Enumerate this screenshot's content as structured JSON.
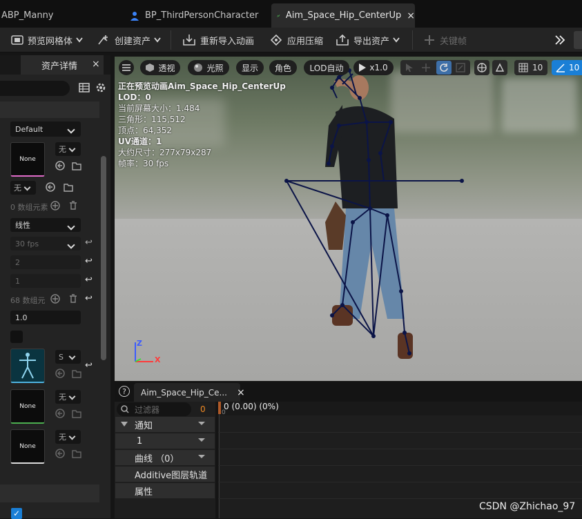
{
  "tabs": [
    {
      "label": "ABP_Manny"
    },
    {
      "label": "BP_ThirdPersonCharacter"
    },
    {
      "label": "Aim_Space_Hip_CenterUp",
      "close": "×"
    }
  ],
  "toolbar": {
    "preview_mesh": "预览网格体",
    "create_asset": "创建资产",
    "reimport": "重新导入动画",
    "apply_compression": "应用压缩",
    "export_asset": "导出资产",
    "keyframe": "关键帧"
  },
  "details": {
    "tab_label": "资产详情",
    "close": "×",
    "fields": {
      "default": "Default",
      "none1": "None",
      "sel_a": "无",
      "sel_b": "无",
      "array0": "0 数组元素",
      "interp": "线性",
      "fps": "30 fps",
      "val2": "2",
      "val1": "1",
      "array68": "68 数组元",
      "rate": "1.0",
      "skel_sel": "S",
      "none2": "None",
      "sel_c": "无",
      "none3": "None",
      "sel_d": "无"
    }
  },
  "viewport": {
    "buttons": {
      "perspective": "透视",
      "lit": "光照",
      "show": "显示",
      "character": "角色",
      "lod": "LOD自动",
      "speed": "x1.0",
      "grid": "10",
      "angle": "10"
    },
    "stats": [
      "正在预览动画Aim_Space_Hip_CenterUp",
      "LOD：0",
      "当前屏幕大小：1.484",
      "三角形：115,512",
      "顶点：64,352",
      "UV通道：1",
      "大约尺寸：277x79x287",
      "帧率：30 fps"
    ],
    "axis": {
      "z": "Z",
      "x": "X"
    }
  },
  "timeline": {
    "tab_label": "Aim_Space_Hip_Ce...",
    "close": "×",
    "help": "?",
    "filter_placeholder": "过滤器",
    "frame_count": "0",
    "frame_label": "0 (0.00) (0%)",
    "frame_tick": "0",
    "rows": {
      "notify": "通知",
      "track1": "1",
      "curves": "曲线 （0）",
      "additive": "Additive图层轨道",
      "attributes": "属性"
    }
  },
  "watermark": "CSDN @Zhichao_97",
  "colors": {
    "accent": "#1a7fd6",
    "active_tab_icon": "#4caf50",
    "axis_x": "#ff3a3a",
    "axis_z": "#3b5bff",
    "skeleton": "#0b1447"
  }
}
